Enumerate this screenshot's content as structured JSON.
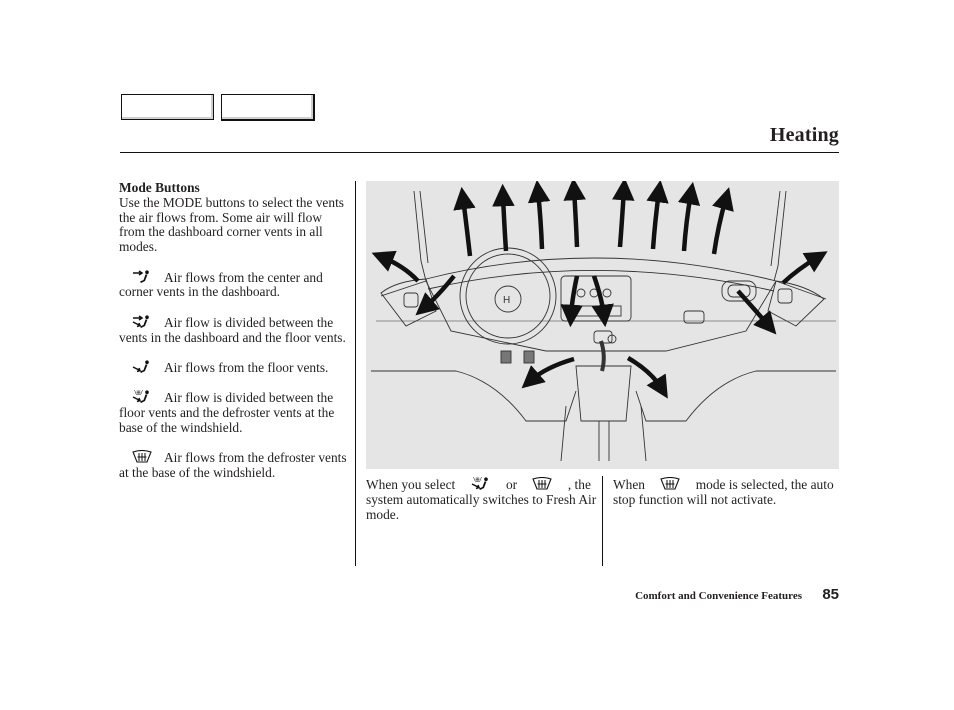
{
  "header": {
    "nav_tabs": [
      "",
      ""
    ],
    "title": "Heating"
  },
  "left_column": {
    "section_heading": "Mode Buttons",
    "intro": "Use the MODE buttons to select the vents the air flows from. Some air will flow from the dashboard corner vents in all modes.",
    "modes": [
      {
        "icon": "vent-mode-icon",
        "text": "Air flows from the center and corner vents in the dashboard."
      },
      {
        "icon": "bi-level-mode-icon",
        "text": "Air flow is divided between the vents in the dashboard and the floor vents."
      },
      {
        "icon": "floor-mode-icon",
        "text": "Air flows from the floor vents."
      },
      {
        "icon": "floor-defrost-mode-icon",
        "text": "Air flow is divided between the floor vents and the defroster vents at the base of the windshield."
      },
      {
        "icon": "defrost-mode-icon",
        "text": "Air flows from the defroster vents at the base of the windshield."
      }
    ]
  },
  "figure": {
    "description": "Dashboard illustration with arrows showing air flow directions from vents"
  },
  "middle_note": {
    "part1": "When you select",
    "part2": "or",
    "part3": ", the system automatically switches to Fresh Air mode."
  },
  "right_note": {
    "part1": "When",
    "part2": "mode is selected, the auto stop function will not activate."
  },
  "footer": {
    "section": "Comfort and Convenience Features",
    "page_number": "85"
  }
}
